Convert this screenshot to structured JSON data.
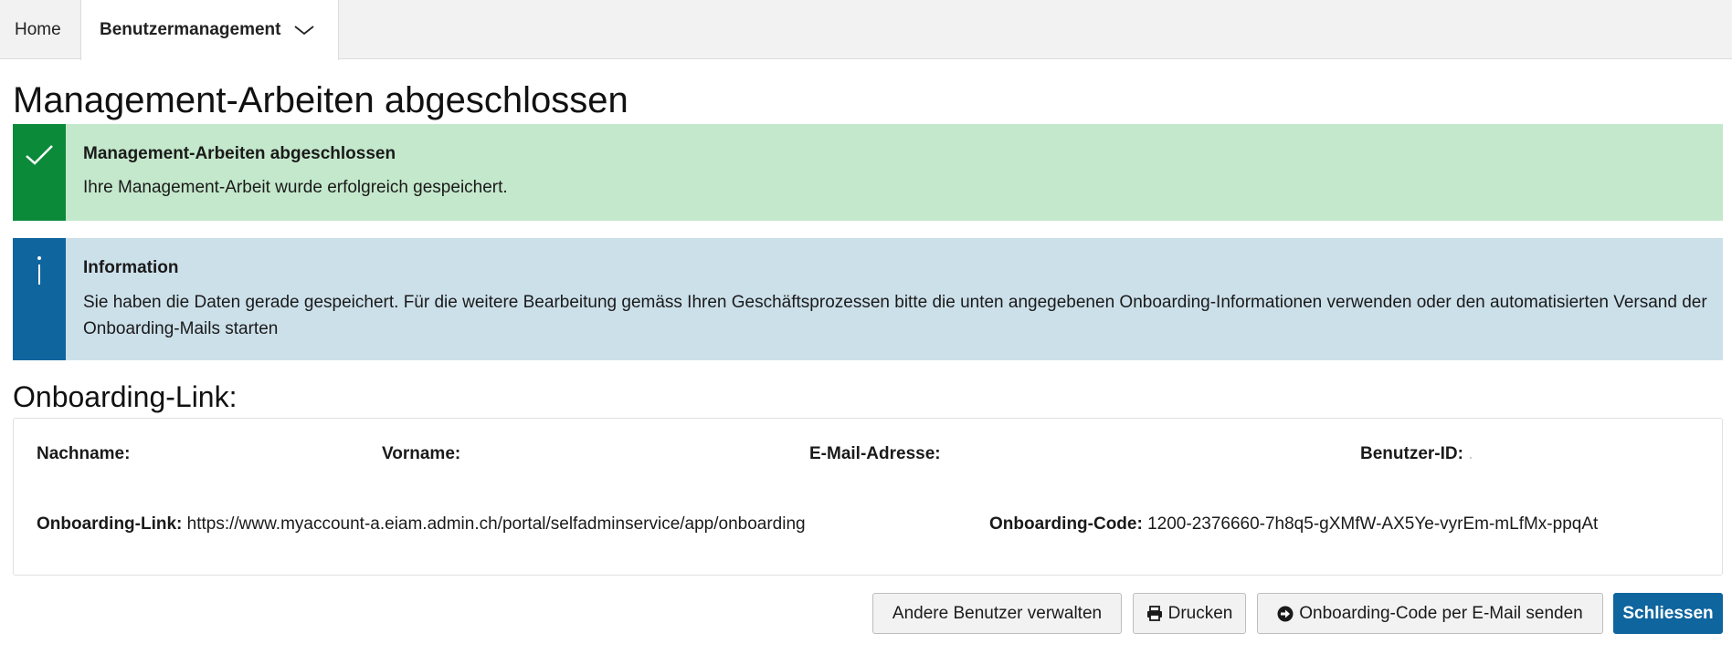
{
  "nav": {
    "home_label": "Home",
    "user_mgmt_label": "Benutzermanagement",
    "user_mgmt_icon": "chevron-down-icon"
  },
  "page": {
    "title": "Management-Arbeiten abgeschlossen"
  },
  "alerts": {
    "success": {
      "icon": "checkmark-icon",
      "title": "Management-Arbeiten abgeschlossen",
      "text": "Ihre Management-Arbeit wurde erfolgreich gespeichert.",
      "accent_color": "#0b8a3a",
      "background_color": "#c4e8cc"
    },
    "info": {
      "icon": "info-icon",
      "title": "Information",
      "text": "Sie haben die Daten gerade gespeichert. Für die weitere Bearbeitung gemäss Ihren Geschäftsprozessen bitte die unten angegebenen Onboarding-Informationen verwenden oder den automatisierten Versand der Onboarding-Mails starten",
      "accent_color": "#0f659e",
      "background_color": "#cce0ea"
    }
  },
  "onboarding": {
    "section_title": "Onboarding-Link:",
    "nachname_label": "Nachname:",
    "nachname_value": "",
    "vorname_label": "Vorname:",
    "vorname_value": "",
    "email_label": "E-Mail-Adresse:",
    "email_value": "",
    "benutzer_id_label": "Benutzer-ID:",
    "benutzer_id_value": ".",
    "link_label": "Onboarding-Link:",
    "link_value": "https://www.myaccount-a.eiam.admin.ch/portal/selfadminservice/app/onboarding",
    "code_label": "Onboarding-Code:",
    "code_value": "1200-2376660-7h8q5-gXMfW-AX5Ye-vyrEm-mLfMx-ppqAt"
  },
  "buttons": {
    "manage_others": "Andere Benutzer verwalten",
    "print": "Drucken",
    "print_icon": "printer-icon",
    "send_code": "Onboarding-Code per E-Mail senden",
    "send_icon": "arrow-circle-right-icon",
    "close": "Schliessen",
    "primary_color": "#0f659e"
  }
}
